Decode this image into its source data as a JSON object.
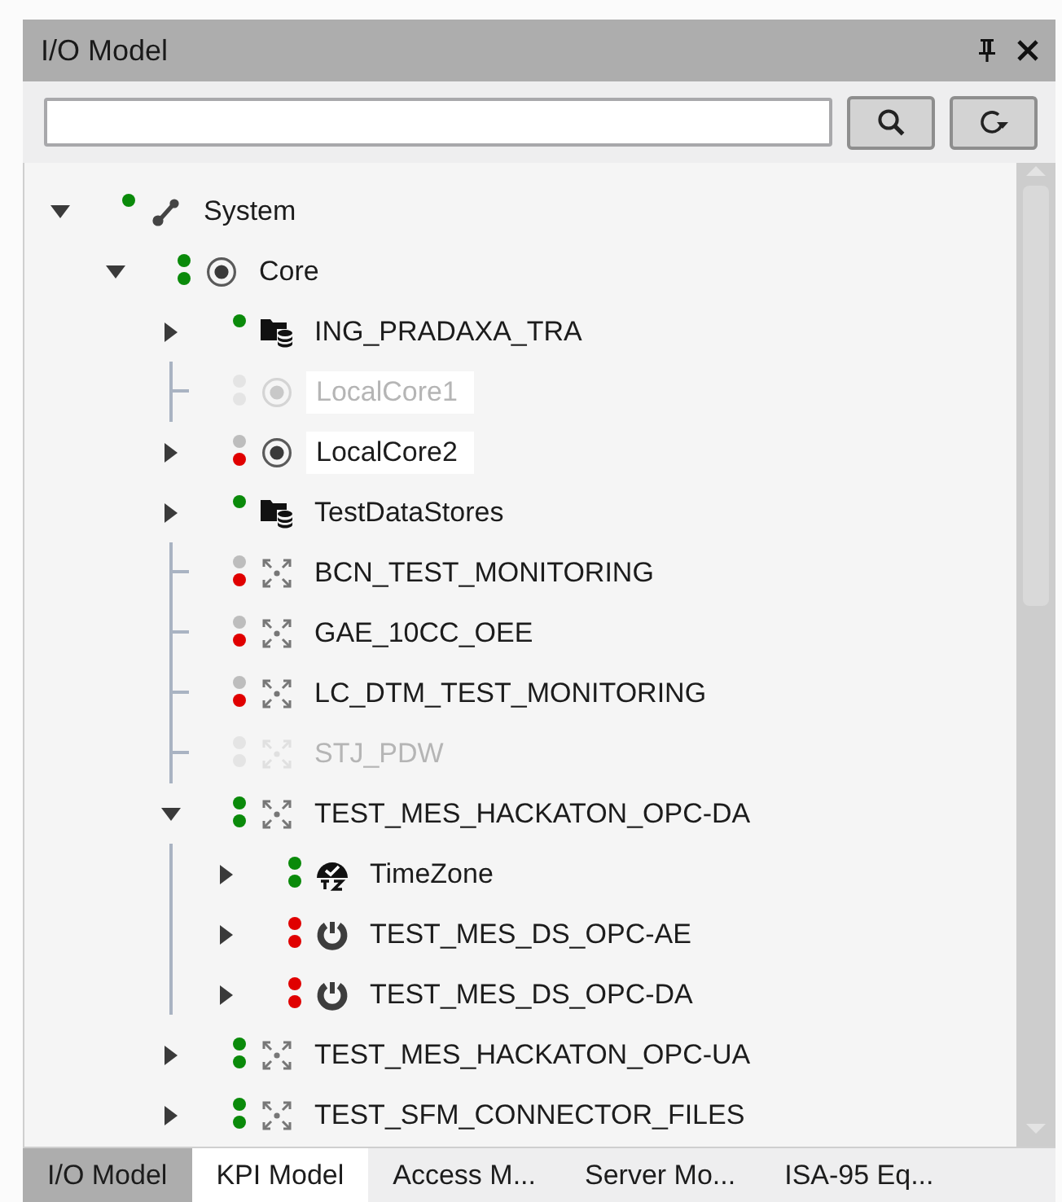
{
  "window": {
    "title": "I/O Model"
  },
  "tree": [
    {
      "label": "System",
      "kind": "system",
      "expanded": true,
      "disabled": false,
      "highlighted": false,
      "dots": [
        {
          "color": "#0a8a0a"
        }
      ],
      "children": [
        {
          "label": "Core",
          "kind": "core",
          "expanded": true,
          "disabled": false,
          "highlighted": false,
          "dots": [
            {
              "color": "#0a8a0a"
            },
            {
              "color": "#0a8a0a"
            }
          ],
          "children": [
            {
              "label": "ING_PRADAXA_TRA",
              "kind": "datastore",
              "expanded": false,
              "disabled": false,
              "highlighted": false,
              "dots": [
                {
                  "color": "#0a8a0a"
                }
              ]
            },
            {
              "label": "LocalCore1",
              "kind": "core",
              "disabled": true,
              "highlighted": true,
              "dots": [
                {
                  "color": "#e4e4e4"
                },
                {
                  "color": "#e4e4e4"
                }
              ]
            },
            {
              "label": "LocalCore2",
              "kind": "core",
              "expanded": false,
              "disabled": false,
              "highlighted": true,
              "dots": [
                {
                  "color": "#bdbdbd"
                },
                {
                  "color": "#e00000"
                }
              ]
            },
            {
              "label": "TestDataStores",
              "kind": "datastore",
              "expanded": false,
              "disabled": false,
              "highlighted": false,
              "dots": [
                {
                  "color": "#0a8a0a"
                }
              ]
            },
            {
              "label": "BCN_TEST_MONITORING",
              "kind": "connector",
              "disabled": false,
              "highlighted": false,
              "dots": [
                {
                  "color": "#bdbdbd"
                },
                {
                  "color": "#e00000"
                }
              ]
            },
            {
              "label": "GAE_10CC_OEE",
              "kind": "connector",
              "disabled": false,
              "highlighted": false,
              "dots": [
                {
                  "color": "#bdbdbd"
                },
                {
                  "color": "#e00000"
                }
              ]
            },
            {
              "label": "LC_DTM_TEST_MONITORING",
              "kind": "connector",
              "disabled": false,
              "highlighted": false,
              "dots": [
                {
                  "color": "#bdbdbd"
                },
                {
                  "color": "#e00000"
                }
              ]
            },
            {
              "label": "STJ_PDW",
              "kind": "connector",
              "disabled": true,
              "highlighted": false,
              "dots": [
                {
                  "color": "#e4e4e4"
                },
                {
                  "color": "#e4e4e4"
                }
              ]
            },
            {
              "label": "TEST_MES_HACKATON_OPC-DA",
              "kind": "connector",
              "expanded": true,
              "disabled": false,
              "highlighted": false,
              "dots": [
                {
                  "color": "#0a8a0a"
                },
                {
                  "color": "#0a8a0a"
                }
              ],
              "children": [
                {
                  "label": "TimeZone",
                  "kind": "timezone",
                  "expanded": false,
                  "disabled": false,
                  "highlighted": false,
                  "dots": [
                    {
                      "color": "#0a8a0a"
                    },
                    {
                      "color": "#0a8a0a"
                    }
                  ]
                },
                {
                  "label": "TEST_MES_DS_OPC-AE",
                  "kind": "power",
                  "expanded": false,
                  "disabled": false,
                  "highlighted": false,
                  "dots": [
                    {
                      "color": "#e00000"
                    },
                    {
                      "color": "#e00000"
                    }
                  ]
                },
                {
                  "label": "TEST_MES_DS_OPC-DA",
                  "kind": "power",
                  "expanded": false,
                  "disabled": false,
                  "highlighted": false,
                  "dots": [
                    {
                      "color": "#e00000"
                    },
                    {
                      "color": "#e00000"
                    }
                  ]
                }
              ]
            },
            {
              "label": "TEST_MES_HACKATON_OPC-UA",
              "kind": "connector",
              "expanded": false,
              "disabled": false,
              "highlighted": false,
              "dots": [
                {
                  "color": "#0a8a0a"
                },
                {
                  "color": "#0a8a0a"
                }
              ]
            },
            {
              "label": "TEST_SFM_CONNECTOR_FILES",
              "kind": "connector",
              "expanded": false,
              "disabled": false,
              "highlighted": false,
              "dots": [
                {
                  "color": "#0a8a0a"
                },
                {
                  "color": "#0a8a0a"
                }
              ]
            }
          ]
        }
      ]
    }
  ],
  "tabs": [
    {
      "label": "I/O Model",
      "selected": true,
      "hovered": false
    },
    {
      "label": "KPI Model",
      "selected": false,
      "hovered": true
    },
    {
      "label": "Access M...",
      "selected": false,
      "hovered": false
    },
    {
      "label": "Server Mo...",
      "selected": false,
      "hovered": false
    },
    {
      "label": "ISA-95 Eq...",
      "selected": false,
      "hovered": false
    }
  ]
}
